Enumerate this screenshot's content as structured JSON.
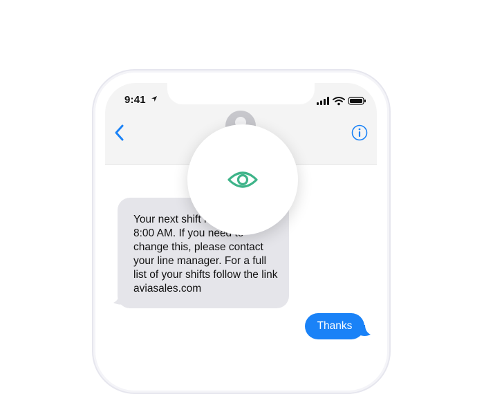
{
  "status_bar": {
    "time": "9:41"
  },
  "nav": {
    "back_icon": "chevron-left-icon",
    "info_icon": "info-icon",
    "avatar_icon": "person-avatar"
  },
  "messages": {
    "incoming": "Your next shift is tomorrow at 8:00 AM. If you need to change this, please contact your line manager. For a full list of your shifts follow the link aviasales.com",
    "outgoing": "Thanks"
  },
  "overlay": {
    "icon": "eye-icon",
    "color": "#3eb489"
  },
  "colors": {
    "accent": "#1a82f7",
    "incoming_bubble": "#e5e5ea",
    "navbar": "#f4f4f4"
  }
}
